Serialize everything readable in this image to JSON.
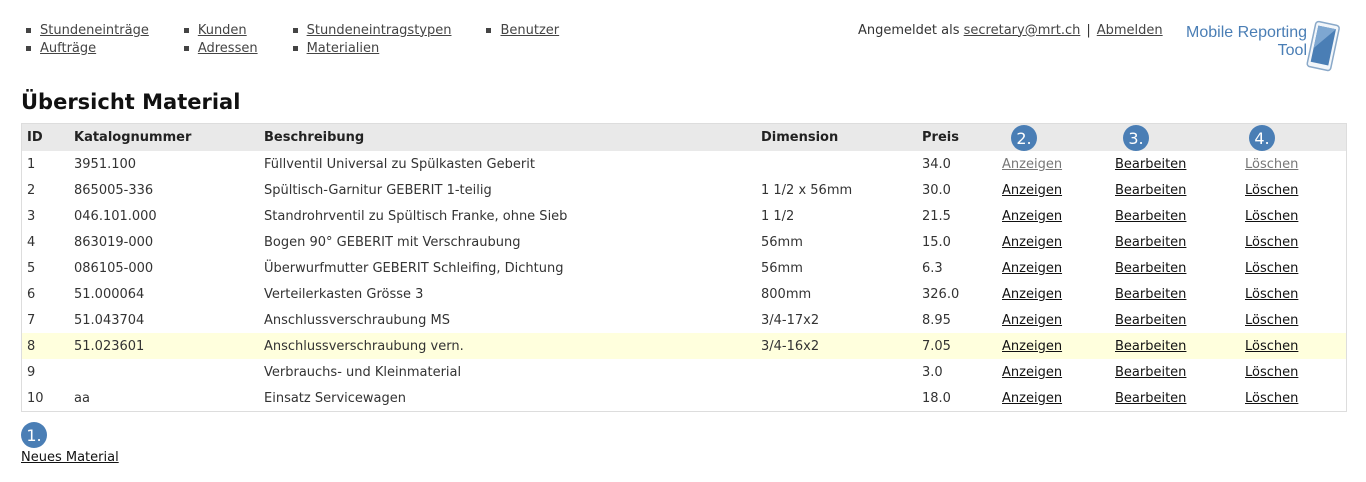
{
  "nav": {
    "columns": [
      [
        "Stundeneinträge",
        "Aufträge"
      ],
      [
        "Kunden",
        "Adressen"
      ],
      [
        "Stundeneintragstypen",
        "Materialien"
      ],
      [
        "Benutzer"
      ]
    ]
  },
  "header": {
    "logged_in_label": "Angemeldet als",
    "user_email": "secretary@mrt.ch",
    "separator": "|",
    "logout_label": "Abmelden",
    "logo_line1": "Mobile Reporting",
    "logo_line2": "Tool"
  },
  "page_title": "Übersicht Material",
  "table": {
    "headers": [
      "ID",
      "Katalognummer",
      "Beschreibung",
      "Dimension",
      "Preis",
      "",
      "",
      ""
    ],
    "action_labels": {
      "show": "Anzeigen",
      "edit": "Bearbeiten",
      "delete": "Löschen"
    },
    "rows": [
      {
        "id": "1",
        "catalog": "3951.100",
        "description": "Füllventil Universal zu Spülkasten Geberit",
        "dimension": "",
        "price": "34.0"
      },
      {
        "id": "2",
        "catalog": "865005-336",
        "description": "Spültisch-Garnitur GEBERIT 1-teilig",
        "dimension": "1 1/2 x 56mm",
        "price": "30.0"
      },
      {
        "id": "3",
        "catalog": "046.101.000",
        "description": "Standrohrventil zu Spültisch Franke, ohne Sieb",
        "dimension": "1 1/2",
        "price": "21.5"
      },
      {
        "id": "4",
        "catalog": "863019-000",
        "description": "Bogen 90° GEBERIT mit Verschraubung",
        "dimension": "56mm",
        "price": "15.0"
      },
      {
        "id": "5",
        "catalog": "086105-000",
        "description": "Überwurfmutter GEBERIT Schleifing, Dichtung",
        "dimension": "56mm",
        "price": "6.3"
      },
      {
        "id": "6",
        "catalog": "51.000064",
        "description": "Verteilerkasten Grösse 3",
        "dimension": "800mm",
        "price": "326.0"
      },
      {
        "id": "7",
        "catalog": "51.043704",
        "description": "Anschlussverschraubung MS",
        "dimension": "3/4-17x2",
        "price": "8.95"
      },
      {
        "id": "8",
        "catalog": "51.023601",
        "description": "Anschlussverschraubung vern.",
        "dimension": "3/4-16x2",
        "price": "7.05"
      },
      {
        "id": "9",
        "catalog": "",
        "description": "Verbrauchs- und Kleinmaterial",
        "dimension": "",
        "price": "3.0"
      },
      {
        "id": "10",
        "catalog": "aa",
        "description": "Einsatz Servicewagen",
        "dimension": "",
        "price": "18.0"
      }
    ]
  },
  "markers": [
    "1.",
    "2.",
    "3.",
    "4."
  ],
  "new_material_label": "Neues Material",
  "colors": {
    "accent": "#4a7eb5",
    "header_bg": "#e9e9e9",
    "highlight_row": "#ffffdd"
  }
}
